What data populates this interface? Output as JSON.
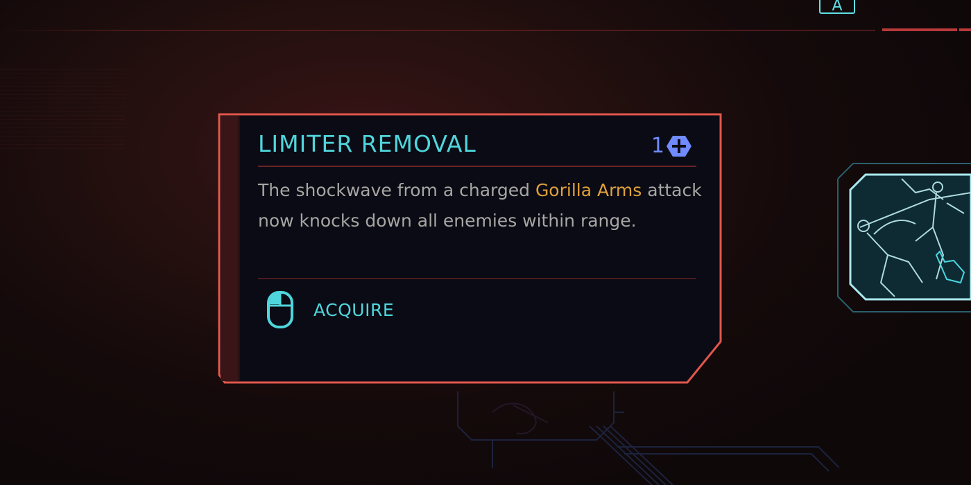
{
  "hud": {
    "key_hint": "A"
  },
  "tooltip": {
    "title": "LIMITER REMOVAL",
    "cost": {
      "value": "1",
      "icon": "perk-point-plus-icon"
    },
    "description": {
      "before": "The shockwave from a charged ",
      "highlight": "Gorilla Arms",
      "after": " attack now knocks down all enemies within range."
    },
    "action": {
      "icon": "mouse-left-click-icon",
      "label": "ACQUIRE"
    }
  },
  "perk_icon": {
    "icon": "perk-fighter-kick-icon"
  },
  "colors": {
    "accent_cyan": "#4fd6dc",
    "frame_red": "#e2574c",
    "highlight_orange": "#e0a13a",
    "cost_blue": "#6f8bff",
    "panel_bg": "#0b0b15"
  }
}
